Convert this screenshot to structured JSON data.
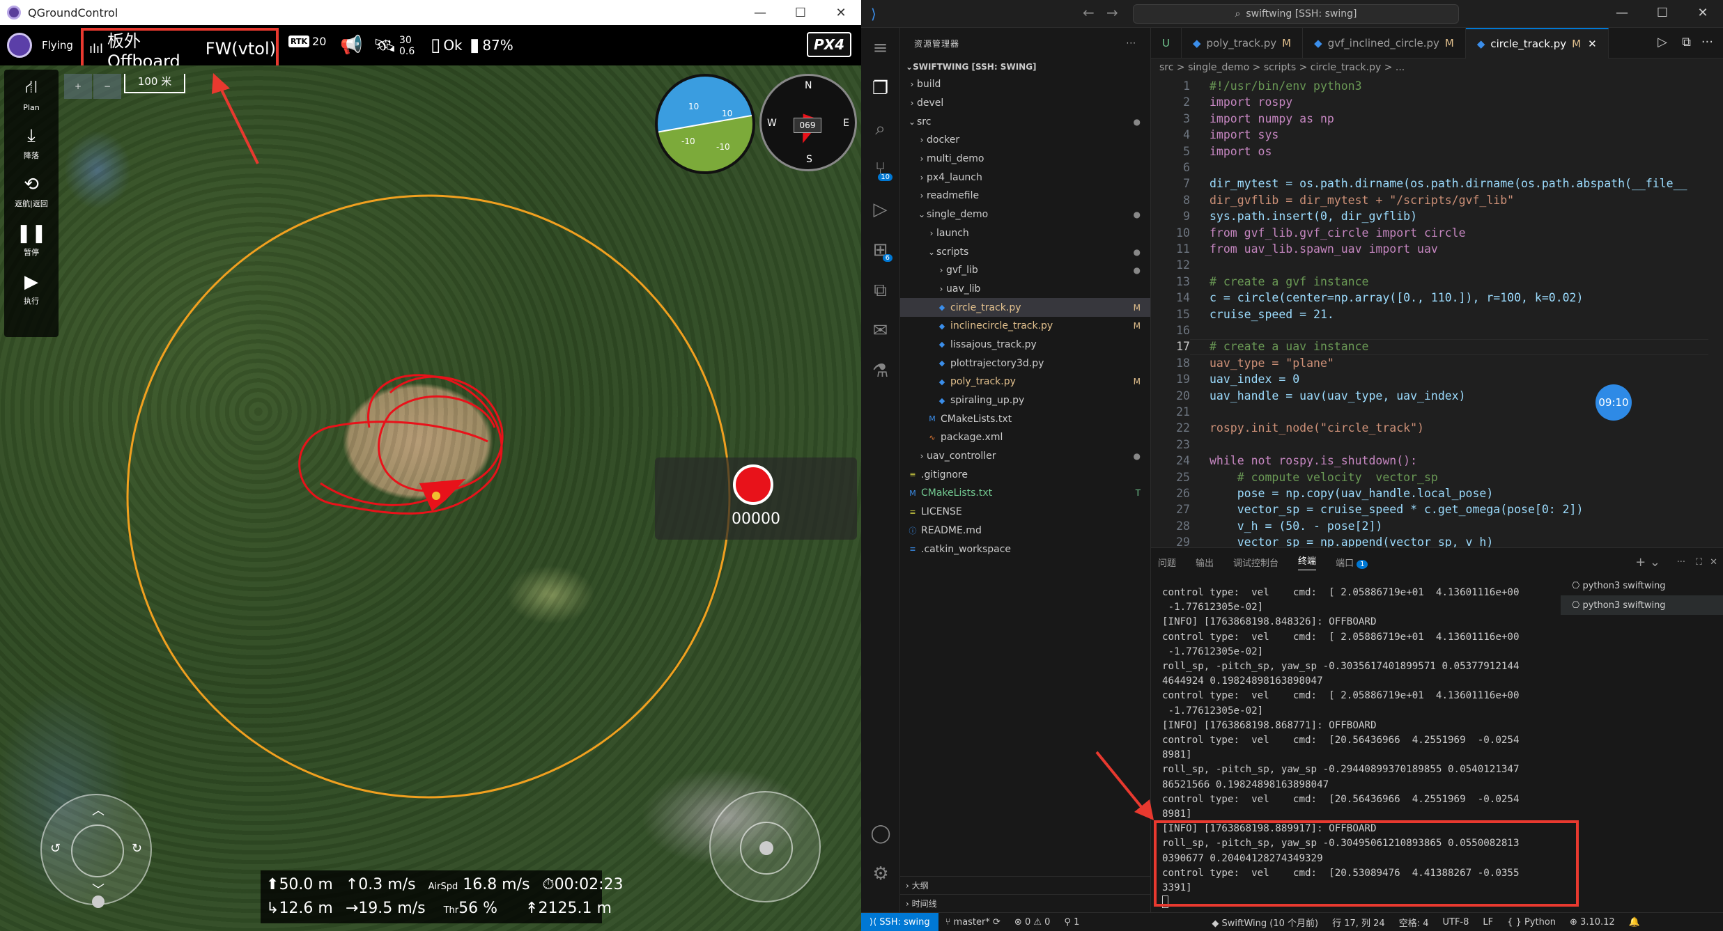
{
  "qgc": {
    "window_title": "QGroundControl",
    "window_controls": [
      "—",
      "☐",
      "✕"
    ],
    "toolbar": {
      "flight_state": "Flying",
      "mode_primary": "板外Offboard",
      "mode_secondary": "FW(vtol)",
      "rtk_label": "RTK",
      "rtk_value": "20",
      "sat_count": "30",
      "sat_hdop": "0.6",
      "status_ok": "Ok",
      "battery": "87%",
      "logo": "PX4"
    },
    "left_tools": [
      {
        "icon": "plan-icon",
        "label": "Plan"
      },
      {
        "icon": "land-icon",
        "label": "降落"
      },
      {
        "icon": "rtl-icon",
        "label": "返航|返回"
      },
      {
        "icon": "pause-icon",
        "label": "暂停"
      },
      {
        "icon": "play-icon",
        "label": "执行"
      }
    ],
    "scale": "100 米",
    "compass": {
      "N": "N",
      "E": "E",
      "S": "S",
      "W": "W",
      "heading": "069"
    },
    "attitude_labels": [
      "10",
      "10",
      "-10",
      "-10"
    ],
    "record_counter": "00000",
    "telemetry": {
      "alt_rel": "50.0 m",
      "vspeed": "0.3 m/s",
      "airspeed_label": "AirSpd",
      "airspeed": "16.8 m/s",
      "flight_time": "00:02:23",
      "dist": "12.6 m",
      "gspeed": "19.5 m/s",
      "thr_label": "Thr",
      "throttle": "56 %",
      "alt_amsl": "2125.1 m"
    },
    "colors": {
      "track": "#e8121a",
      "loiter_circle": "#f0a020",
      "highlight": "#e8392f"
    }
  },
  "vscode": {
    "search": "swiftwing [SSH: swing]",
    "explorer_header": "资源管理器",
    "workspace_root": "SWIFTWING [SSH: SWING]",
    "tree": [
      {
        "name": "build",
        "depth": 0,
        "type": "folder",
        "open": false,
        "status": ""
      },
      {
        "name": "devel",
        "depth": 0,
        "type": "folder",
        "open": false,
        "status": ""
      },
      {
        "name": "src",
        "depth": 0,
        "type": "folder",
        "open": true,
        "status": "●"
      },
      {
        "name": "docker",
        "depth": 1,
        "type": "folder",
        "open": false,
        "status": ""
      },
      {
        "name": "multi_demo",
        "depth": 1,
        "type": "folder",
        "open": false,
        "status": ""
      },
      {
        "name": "px4_launch",
        "depth": 1,
        "type": "folder",
        "open": false,
        "status": ""
      },
      {
        "name": "readmefile",
        "depth": 1,
        "type": "folder",
        "open": false,
        "status": ""
      },
      {
        "name": "single_demo",
        "depth": 1,
        "type": "folder",
        "open": true,
        "status": "●"
      },
      {
        "name": "launch",
        "depth": 2,
        "type": "folder",
        "open": false,
        "status": ""
      },
      {
        "name": "scripts",
        "depth": 2,
        "type": "folder",
        "open": true,
        "status": "●"
      },
      {
        "name": "gvf_lib",
        "depth": 3,
        "type": "folder",
        "open": false,
        "status": "●"
      },
      {
        "name": "uav_lib",
        "depth": 3,
        "type": "folder",
        "open": false,
        "status": ""
      },
      {
        "name": "circle_track.py",
        "depth": 3,
        "type": "py",
        "status": "M",
        "selected": true
      },
      {
        "name": "inclinecircle_track.py",
        "depth": 3,
        "type": "py",
        "status": "M"
      },
      {
        "name": "lissajous_track.py",
        "depth": 3,
        "type": "py",
        "status": ""
      },
      {
        "name": "plottrajectory3d.py",
        "depth": 3,
        "type": "py",
        "status": ""
      },
      {
        "name": "poly_track.py",
        "depth": 3,
        "type": "py",
        "status": "M"
      },
      {
        "name": "spiraling_up.py",
        "depth": 3,
        "type": "py",
        "status": ""
      },
      {
        "name": "CMakeLists.txt",
        "depth": 2,
        "type": "cmake",
        "status": ""
      },
      {
        "name": "package.xml",
        "depth": 2,
        "type": "xml",
        "status": ""
      },
      {
        "name": "uav_controller",
        "depth": 1,
        "type": "folder",
        "open": false,
        "status": "●"
      },
      {
        "name": ".gitignore",
        "depth": 0,
        "type": "git",
        "status": ""
      },
      {
        "name": "CMakeLists.txt",
        "depth": 0,
        "type": "cmake",
        "status": "T"
      },
      {
        "name": "LICENSE",
        "depth": 0,
        "type": "license",
        "status": ""
      },
      {
        "name": "README.md",
        "depth": 0,
        "type": "md",
        "status": ""
      },
      {
        "name": ".catkin_workspace",
        "depth": 0,
        "type": "file",
        "status": ""
      }
    ],
    "outline_label": "大纲",
    "timeline_label": "时间线",
    "tabs": [
      {
        "name": "U",
        "mod": "",
        "active": false
      },
      {
        "name": "poly_track.py",
        "mod": "M",
        "active": false
      },
      {
        "name": "gvf_inclined_circle.py",
        "mod": "M",
        "active": false
      },
      {
        "name": "circle_track.py",
        "mod": "M",
        "active": true
      }
    ],
    "breadcrumb": "src  >  single_demo  >  scripts  >  circle_track.py  >  ...",
    "code_lines": [
      "#!/usr/bin/env python3",
      "import rospy",
      "import numpy as np",
      "import sys",
      "import os",
      "",
      "dir_mytest = os.path.dirname(os.path.dirname(os.path.abspath(__file__",
      "dir_gvflib = dir_mytest + \"/scripts/gvf_lib\"",
      "sys.path.insert(0, dir_gvflib)",
      "from gvf_lib.gvf_circle import circle",
      "from uav_lib.spawn_uav import uav",
      "",
      "# create a gvf instance",
      "c = circle(center=np.array([0., 110.]), r=100, k=0.02)",
      "cruise_speed = 21.",
      "",
      "# create a uav instance",
      "uav_type = \"plane\"",
      "uav_index = 0",
      "uav_handle = uav(uav_type, uav_index)",
      "",
      "rospy.init_node(\"circle_track\")",
      "",
      "while not rospy.is_shutdown():",
      "    # compute velocity  vector_sp",
      "    pose = np.copy(uav_handle.local_pose)",
      "    vector_sp = cruise_speed * c.get_omega(pose[0: 2])",
      "    v_h = (50. - pose[2])",
      "    vector_sp = np.append(vector_sp, v_h)"
    ],
    "timer": "09:10",
    "panel_tabs": [
      "问题",
      "输出",
      "调试控制台",
      "终端",
      "端口"
    ],
    "ports_badge": "1",
    "terminal_lines": [
      "control type:  vel    cmd:  [ 2.05886719e+01  4.13601116e+00",
      " -1.77612305e-02]",
      "[INFO] [1763868198.848326]: OFFBOARD",
      "control type:  vel    cmd:  [ 2.05886719e+01  4.13601116e+00",
      " -1.77612305e-02]",
      "roll_sp, -pitch_sp, yaw_sp -0.3035617401899571 0.05377912144",
      "4644924 0.19824898163898047",
      "control type:  vel    cmd:  [ 2.05886719e+01  4.13601116e+00",
      " -1.77612305e-02]",
      "[INFO] [1763868198.868771]: OFFBOARD",
      "control type:  vel    cmd:  [20.56436966  4.2551969  -0.0254",
      "8981]",
      "roll_sp, -pitch_sp, yaw_sp -0.29440899370189855 0.0540121347",
      "86521566 0.19824898163898047",
      "control type:  vel    cmd:  [20.56436966  4.2551969  -0.0254",
      "8981]",
      "[INFO] [1763868198.889917]: OFFBOARD",
      "roll_sp, -pitch_sp, yaw_sp -0.30495061210893865 0.0550082813",
      "0390677 0.20404128274349329",
      "control type:  vel    cmd:  [20.53089476  4.41388267 -0.0355",
      "3391]"
    ],
    "terminal_sessions": [
      "python3  swiftwing",
      "python3  swiftwing"
    ],
    "status": {
      "remote": "SSH: swing",
      "branch": "master*",
      "errors": "0",
      "warnings": "0",
      "ports": "1",
      "center": "SwiftWing (10 个月前)",
      "position": "行 17, 列 24",
      "indent": "空格: 4",
      "encoding": "UTF-8",
      "eol": "LF",
      "language": "Python",
      "version": "3.10.12"
    }
  }
}
